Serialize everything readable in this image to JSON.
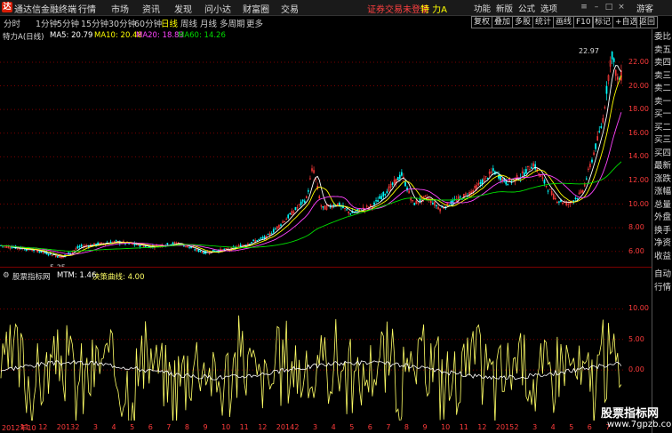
{
  "app": {
    "title": "通达信金融终端"
  },
  "menu": [
    "行情",
    "市场",
    "资讯",
    "发现",
    "问小达",
    "财富圈",
    "交易"
  ],
  "notice": "证券交易未登录",
  "stock_header": "特 力A",
  "right_menu": [
    "功能",
    "新版",
    "公式",
    "选项",
    "游客"
  ],
  "periods": [
    "分时",
    "1分钟",
    "5分钟",
    "15分钟",
    "30分钟",
    "60分钟",
    "日线",
    "周线",
    "月线",
    "多周期",
    "更多"
  ],
  "active_period": "日线",
  "toolbar": [
    "复权",
    "叠加",
    "多股",
    "统计",
    "画线",
    "F10",
    "标记",
    "+自选",
    "返回"
  ],
  "ma_legend": {
    "name": "特力A(日线)",
    "ma5": "MA5: 20.79",
    "ma10": "MA10: 20.48",
    "ma20": "MA20: 18.83",
    "ma60": "MA60: 14.26",
    "colors": {
      "ma5": "#ffffff",
      "ma10": "#ffff00",
      "ma20": "#ff44ff",
      "ma60": "#00dd00"
    }
  },
  "indicator_legend": {
    "name": "股票指标网",
    "mtm": "MTM: 1.46",
    "decision": "决策曲线: 4.00"
  },
  "side_panel": [
    "委比",
    "卖五",
    "卖四",
    "卖三",
    "卖二",
    "卖一",
    "买一",
    "买二",
    "买三",
    "买四",
    "最新",
    "涨跌",
    "涨幅",
    "总量",
    "外盘",
    "换手",
    "净资",
    "收益",
    "自动",
    "行情"
  ],
  "chart_data": [
    {
      "type": "line",
      "series_kind": "candlestick",
      "yticks": [
        6.0,
        8.0,
        10.0,
        12.0,
        14.0,
        16.0,
        18.0,
        20.0,
        22.0
      ],
      "ylim": [
        5.0,
        23.5
      ],
      "annotations": [
        {
          "label": "22.97",
          "value": 22.97
        },
        {
          "label": "5.35",
          "value": 5.35
        }
      ],
      "xlabels": [
        "2012年10",
        "11",
        "12",
        "2013",
        "2",
        "3",
        "4",
        "5",
        "6",
        "7",
        "8",
        "9",
        "10",
        "11",
        "12",
        "2014",
        "2",
        "3",
        "4",
        "5",
        "6",
        "7",
        "8",
        "9",
        "10",
        "11",
        "12",
        "2015",
        "2",
        "3",
        "4",
        "5",
        "6",
        "7"
      ],
      "colors": {
        "up": "#ff3b3b",
        "down": "#00ffff",
        "grid": "#7a0000"
      }
    },
    {
      "type": "line",
      "yticks": [
        0.0,
        5.0,
        10.0
      ],
      "ylim": [
        -8,
        14
      ],
      "series": [
        {
          "name": "MTM",
          "color": "#ffffff"
        },
        {
          "name": "决策曲线",
          "color": "#ffff66"
        }
      ]
    }
  ],
  "watermark": {
    "line1": "股票指标网",
    "line2": "www.7gpzb.com"
  }
}
